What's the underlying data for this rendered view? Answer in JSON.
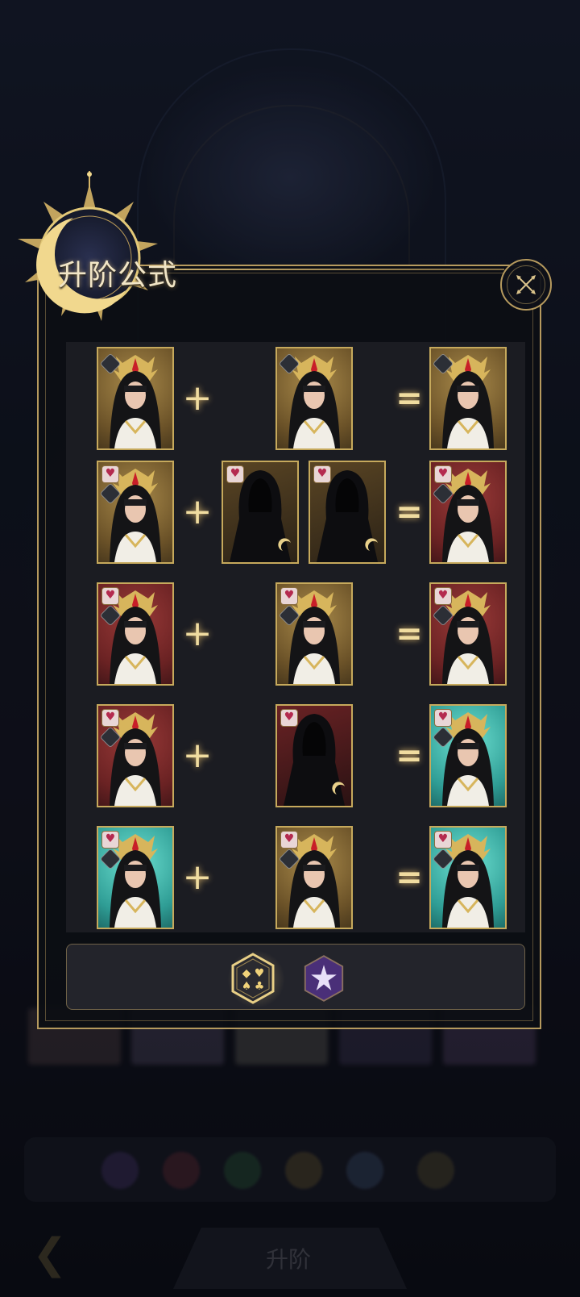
{
  "popup": {
    "title": "升阶公式",
    "close_icon": "close-x-icon"
  },
  "formula_rows": [
    {
      "inputs_left": [
        {
          "rarity": "gold",
          "heart": false
        }
      ],
      "operator": "+",
      "inputs_right": [
        {
          "rarity": "gold",
          "heart": false,
          "hooded": false
        }
      ],
      "result": {
        "rarity": "gold",
        "heart": false
      }
    },
    {
      "inputs_left": [
        {
          "rarity": "gold",
          "heart": true
        }
      ],
      "operator": "+",
      "inputs_right": [
        {
          "rarity": "gold",
          "heart": true,
          "hooded": true
        },
        {
          "rarity": "gold",
          "heart": true,
          "hooded": true
        }
      ],
      "result": {
        "rarity": "red",
        "heart": true
      }
    },
    {
      "inputs_left": [
        {
          "rarity": "red",
          "heart": true
        }
      ],
      "operator": "+",
      "inputs_right": [
        {
          "rarity": "gold",
          "heart": true,
          "hooded": false
        }
      ],
      "result": {
        "rarity": "red",
        "heart": true
      }
    },
    {
      "inputs_left": [
        {
          "rarity": "red",
          "heart": true
        }
      ],
      "operator": "+",
      "inputs_right": [
        {
          "rarity": "red",
          "heart": true,
          "hooded": true
        }
      ],
      "result": {
        "rarity": "teal",
        "heart": true
      }
    },
    {
      "inputs_left": [
        {
          "rarity": "teal",
          "heart": true
        }
      ],
      "operator": "+",
      "inputs_right": [
        {
          "rarity": "gold",
          "heart": true,
          "hooded": false
        }
      ],
      "result": {
        "rarity": "teal",
        "heart": true
      }
    }
  ],
  "tabs": [
    {
      "icon": "card-suits-icon",
      "selected": true
    },
    {
      "icon": "purple-star-icon",
      "selected": false
    }
  ],
  "background": {
    "button_label": "升阶"
  },
  "colors": {
    "gold_frame": "#c6a95c",
    "gold_rarity": "#a98a4a",
    "red_rarity": "#9a3a38",
    "teal_rarity": "#6de0d1",
    "accent_text": "#f1e5c6"
  }
}
